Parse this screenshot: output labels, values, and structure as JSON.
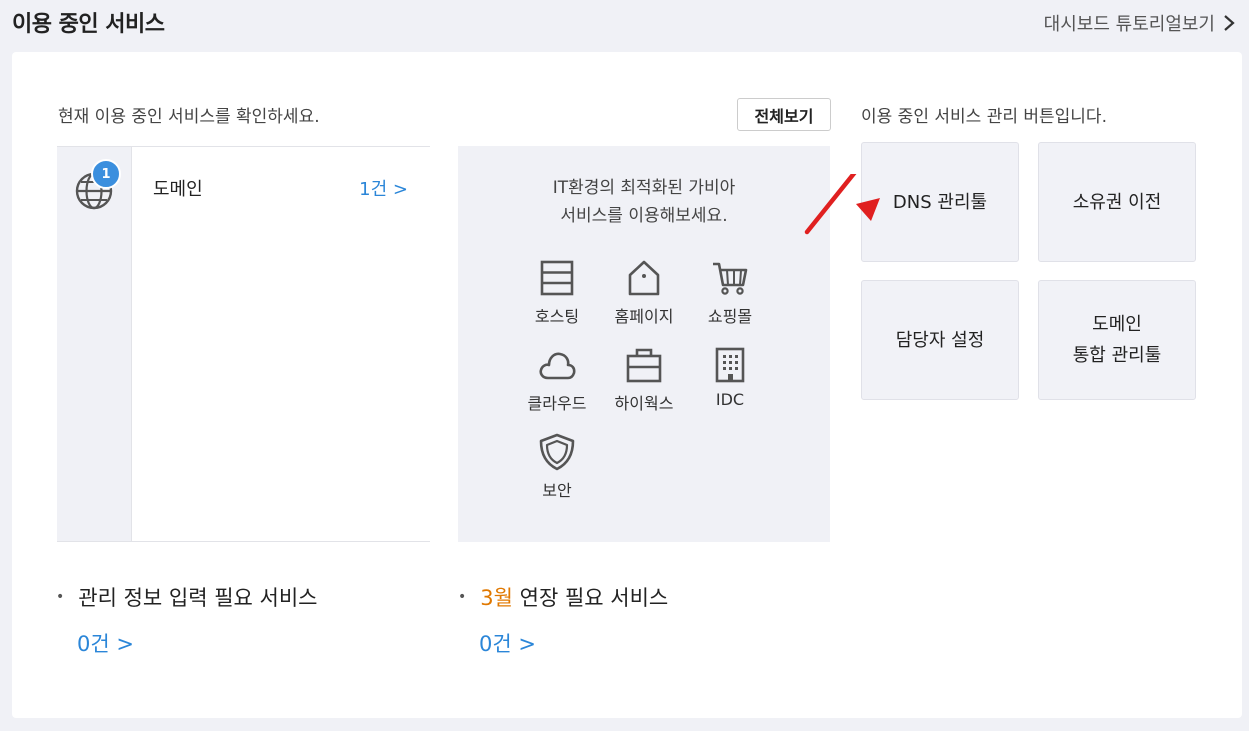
{
  "header": {
    "title": "이용 중인 서비스",
    "tutorial_link": "대시보드 튜토리얼보기"
  },
  "card": {
    "desc_left": "현재 이용 중인 서비스를 확인하세요.",
    "view_all": "전체보기",
    "desc_right": "이용 중인 서비스 관리 버튼입니다."
  },
  "service_list": {
    "badge": "1",
    "item_name": "도메인",
    "item_count": "1건 >"
  },
  "promo": {
    "line1": "IT환경의 최적화된 가비아",
    "line2": "서비스를 이용해보세요.",
    "items": [
      {
        "label": "호스팅",
        "icon": "hosting-icon"
      },
      {
        "label": "홈페이지",
        "icon": "home-icon"
      },
      {
        "label": "쇼핑몰",
        "icon": "cart-icon"
      },
      {
        "label": "클라우드",
        "icon": "cloud-icon"
      },
      {
        "label": "하이웍스",
        "icon": "briefcase-icon"
      },
      {
        "label": "IDC",
        "icon": "building-icon"
      },
      {
        "label": "보안",
        "icon": "shield-icon"
      }
    ]
  },
  "management": {
    "dns": "DNS 관리툴",
    "transfer": "소유권 이전",
    "contact": "담당자 설정",
    "domain_tool_line1": "도메인",
    "domain_tool_line2": "통합 관리툴"
  },
  "bottom": {
    "info_title": "관리 정보 입력 필요 서비스",
    "info_count": "0건 >",
    "renew_month": "3월",
    "renew_title": " 연장 필요 서비스",
    "renew_count": "0건 >",
    "bullet": "•"
  },
  "colors": {
    "accent_blue": "#2b86d8",
    "badge_blue": "#3b8fde",
    "highlight_orange": "#e07800",
    "arrow_red": "#e02020",
    "panel_bg": "#f0f1f6"
  }
}
